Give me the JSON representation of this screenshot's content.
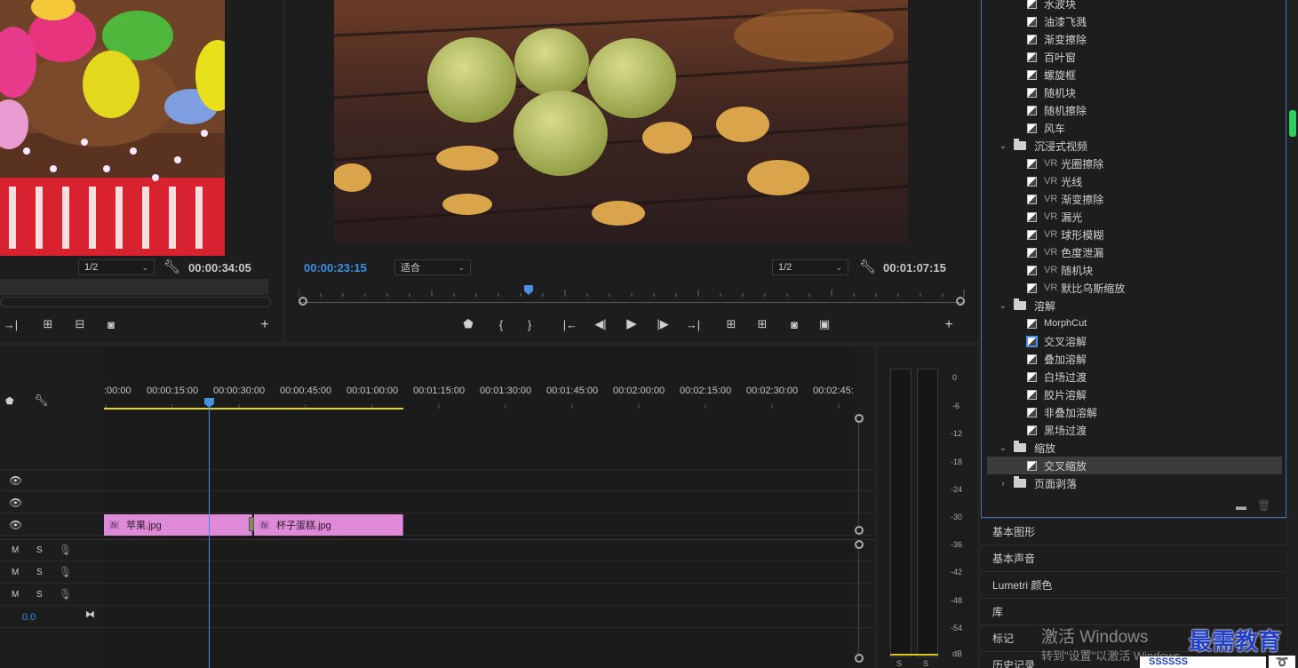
{
  "source_monitor": {
    "zoom": "1/2",
    "duration": "00:00:34:05"
  },
  "program_monitor": {
    "current_time": "00:00:23:15",
    "fit": "适合",
    "zoom": "1/2",
    "duration": "00:01:07:15"
  },
  "timeline": {
    "ruler": [
      ":00:00",
      "00:00:15:00",
      "00:00:30:00",
      "00:00:45:00",
      "00:01:00:00",
      "00:01:15:00",
      "00:01:30:00",
      "00:01:45:00",
      "00:02:00:00",
      "00:02:15:00",
      "00:02:30:00",
      "00:02:45:"
    ],
    "clips": [
      {
        "name": "苹果.jpg",
        "fx": "fx"
      },
      {
        "name": "杯子蛋糕.jpg",
        "fx": "fx"
      }
    ],
    "audio_labels": {
      "m": "M",
      "s": "S"
    },
    "master_volume": "0.0"
  },
  "meters": {
    "scale": [
      "0",
      "-6",
      "-12",
      "-18",
      "-24",
      "-30",
      "-36",
      "-42",
      "-48",
      "-54",
      "dB"
    ],
    "channels": [
      "S",
      "S"
    ]
  },
  "effects": {
    "items": [
      {
        "type": "effect",
        "label": "水波块",
        "vr": ""
      },
      {
        "type": "effect",
        "label": "油漆飞溅",
        "vr": ""
      },
      {
        "type": "effect",
        "label": "渐变擦除",
        "vr": ""
      },
      {
        "type": "effect",
        "label": "百叶窗",
        "vr": ""
      },
      {
        "type": "effect",
        "label": "螺旋框",
        "vr": ""
      },
      {
        "type": "effect",
        "label": "随机块",
        "vr": ""
      },
      {
        "type": "effect",
        "label": "随机擦除",
        "vr": ""
      },
      {
        "type": "effect",
        "label": "风车",
        "vr": ""
      },
      {
        "type": "folder",
        "label": "沉浸式视频",
        "open": true
      },
      {
        "type": "effect",
        "label": "光圈擦除",
        "vr": "VR"
      },
      {
        "type": "effect",
        "label": "光线",
        "vr": "VR"
      },
      {
        "type": "effect",
        "label": "渐变擦除",
        "vr": "VR"
      },
      {
        "type": "effect",
        "label": "漏光",
        "vr": "VR"
      },
      {
        "type": "effect",
        "label": "球形模糊",
        "vr": "VR"
      },
      {
        "type": "effect",
        "label": "色度泄漏",
        "vr": "VR"
      },
      {
        "type": "effect",
        "label": "随机块",
        "vr": "VR"
      },
      {
        "type": "effect",
        "label": "默比乌斯缩放",
        "vr": "VR"
      },
      {
        "type": "folder",
        "label": "溶解",
        "open": true
      },
      {
        "type": "effect",
        "label": "MorphCut",
        "vr": ""
      },
      {
        "type": "effect",
        "label": "交叉溶解",
        "vr": "",
        "highlight": true
      },
      {
        "type": "effect",
        "label": "叠加溶解",
        "vr": ""
      },
      {
        "type": "effect",
        "label": "白场过渡",
        "vr": ""
      },
      {
        "type": "effect",
        "label": "胶片溶解",
        "vr": ""
      },
      {
        "type": "effect",
        "label": "非叠加溶解",
        "vr": ""
      },
      {
        "type": "effect",
        "label": "黑场过渡",
        "vr": ""
      },
      {
        "type": "folder",
        "label": "缩放",
        "open": true
      },
      {
        "type": "effect",
        "label": "交叉缩放",
        "vr": "",
        "selected": true
      },
      {
        "type": "folder",
        "label": "页面剥落",
        "open": false
      }
    ]
  },
  "side_panels": [
    "基本图形",
    "基本声音",
    "Lumetri 颜色",
    "库",
    "标记",
    "历史记录"
  ],
  "watermark": {
    "line1": "激活 Windows",
    "line2": "转到\"设置\"以激活 Windows。",
    "brand": "最需教育",
    "brand_sub": "SSSSSS"
  },
  "colors": {
    "accent_blue": "#3a8fe6",
    "clip_pink": "#df8ad8",
    "playhead": "#4a90e2",
    "work_area": "#e6d81a"
  }
}
